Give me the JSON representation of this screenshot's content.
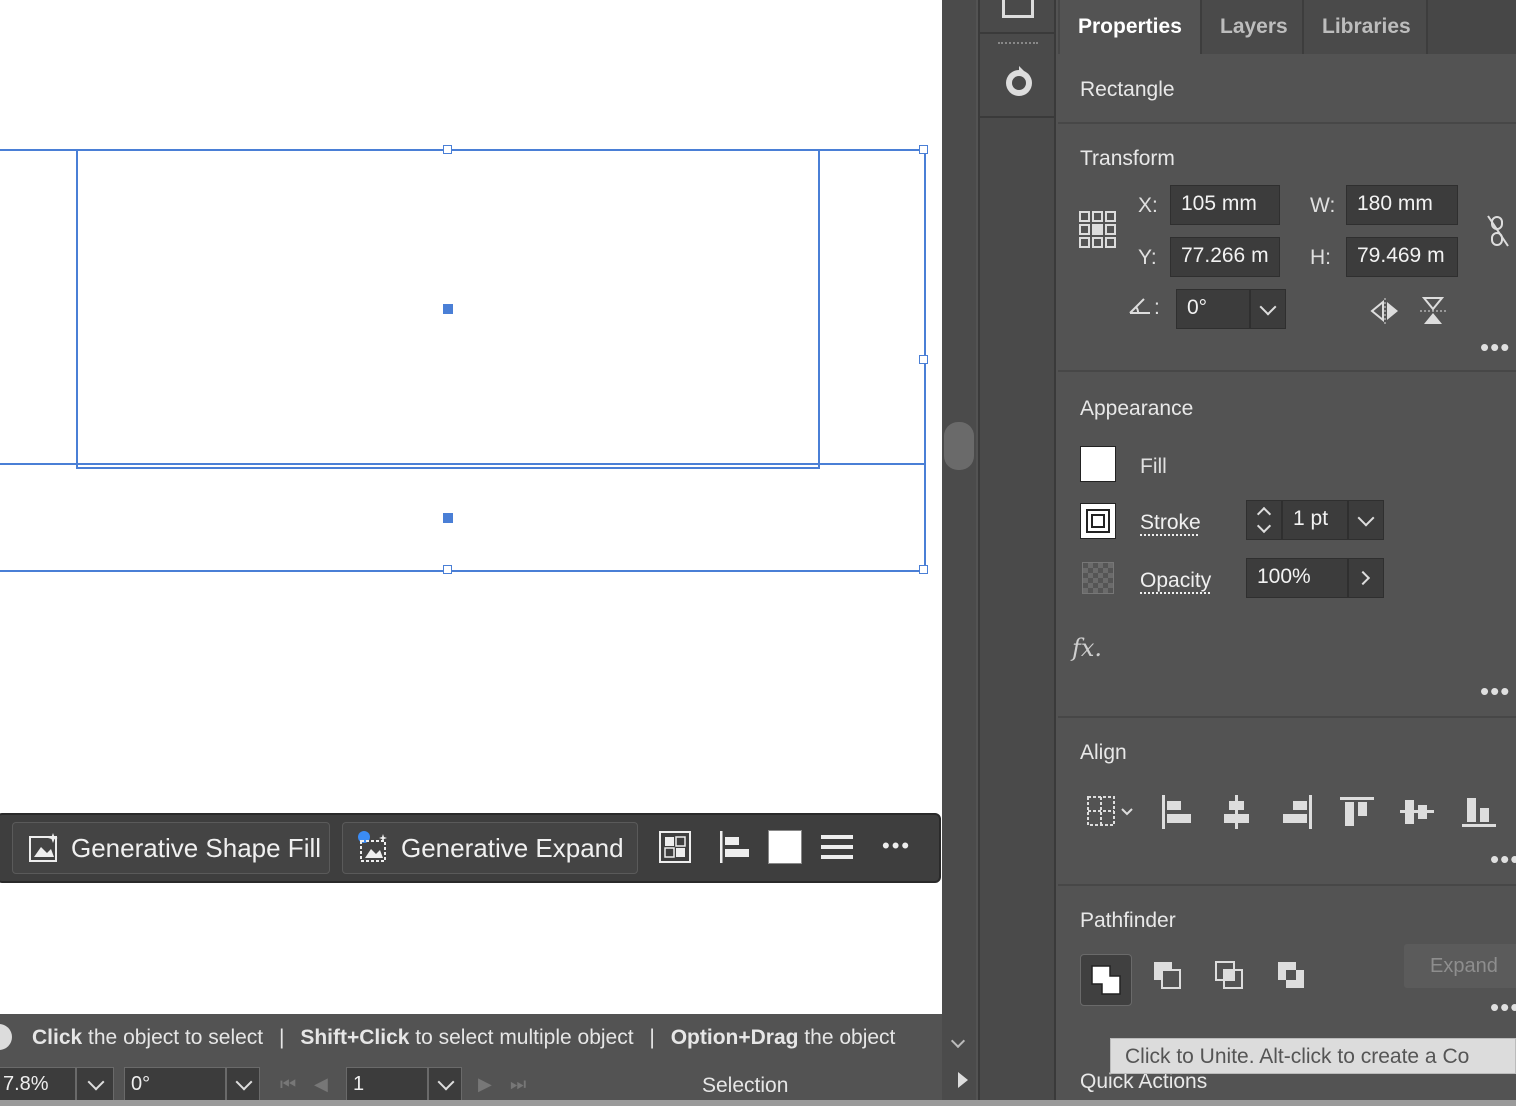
{
  "panel": {
    "tabs": [
      {
        "label": "Properties",
        "active": true
      },
      {
        "label": "Layers",
        "active": false
      },
      {
        "label": "Libraries",
        "active": false
      }
    ],
    "object_type": "Rectangle",
    "transform": {
      "title": "Transform",
      "x_label": "X:",
      "x_value": "105 mm",
      "y_label": "Y:",
      "y_value": "77.266 m",
      "w_label": "W:",
      "w_value": "180 mm",
      "h_label": "H:",
      "h_value": "79.469 m",
      "angle_label": ":",
      "angle_value": "0°"
    },
    "appearance": {
      "title": "Appearance",
      "fill_label": "Fill",
      "stroke_label": "Stroke",
      "stroke_weight": "1 pt",
      "opacity_label": "Opacity",
      "opacity_value": "100%",
      "fx_label": "fx."
    },
    "align": {
      "title": "Align"
    },
    "pathfinder": {
      "title": "Pathfinder",
      "expand_label": "Expand"
    },
    "quick_actions": {
      "title": "Quick Actions"
    },
    "tooltip": "Click to Unite. Alt-click to create a Co"
  },
  "context_bar": {
    "generative_shape_fill": "Generative Shape Fill",
    "generative_expand": "Generative Expand",
    "more": "•••"
  },
  "status_bar": {
    "hint1_bold": "Click",
    "hint1_rest": " the object to select",
    "sep": "|",
    "hint2_bold": "Shift+Click",
    "hint2_rest": " to select multiple object",
    "hint3_bold": "Option+Drag",
    "hint3_rest": " the object"
  },
  "bottom_bar": {
    "zoom": "7.8%",
    "rotation": "0°",
    "artboard": "1",
    "tool": "Selection"
  },
  "colors": {
    "selection": "#4a7fd6",
    "panel_bg": "#535353",
    "field_bg": "#3c3c3c"
  }
}
